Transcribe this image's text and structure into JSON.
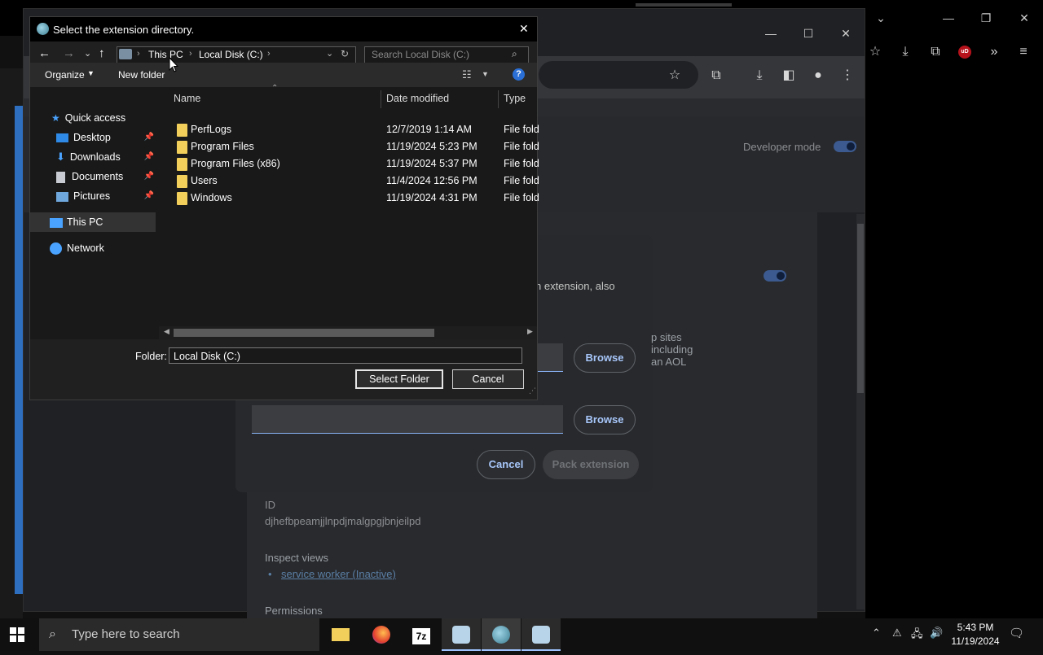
{
  "file_dialog": {
    "title": "Select the extension directory.",
    "close": "✕",
    "address": {
      "segments": [
        "This PC",
        "Local Disk (C:)"
      ]
    },
    "search_placeholder": "Search Local Disk (C:)",
    "organize_label": "Organize",
    "new_folder_label": "New folder",
    "help": "?",
    "nav_pane": {
      "quick_access": "Quick access",
      "items": [
        {
          "label": "Desktop"
        },
        {
          "label": "Downloads"
        },
        {
          "label": "Documents"
        },
        {
          "label": "Pictures"
        }
      ],
      "this_pc": "This PC",
      "network": "Network"
    },
    "columns": {
      "name": "Name",
      "date": "Date modified",
      "type": "Type"
    },
    "rows": [
      {
        "name": "PerfLogs",
        "date": "12/7/2019 1:14 AM",
        "type": "File fold"
      },
      {
        "name": "Program Files",
        "date": "11/19/2024 5:23 PM",
        "type": "File fold"
      },
      {
        "name": "Program Files (x86)",
        "date": "11/19/2024 5:37 PM",
        "type": "File fold"
      },
      {
        "name": "Users",
        "date": "11/4/2024 12:56 PM",
        "type": "File fold"
      },
      {
        "name": "Windows",
        "date": "11/19/2024 4:31 PM",
        "type": "File fold"
      }
    ],
    "folder_label": "Folder:",
    "folder_value": "Local Disk (C:)",
    "select_button": "Select Folder",
    "cancel_button": "Cancel"
  },
  "browser": {
    "developer_mode_label": "Developer mode",
    "pack_dialog": {
      "fragment_text": "n extension, also",
      "fragment_text_2": "p sites including an AOL",
      "browse_label_1": "Browse",
      "browse_label_2": "Browse",
      "cancel_label": "Cancel",
      "pack_label": "Pack extension"
    },
    "details": {
      "id_label": "ID",
      "id_value": "djhefbpeamjjlnpdjmalgpgjbnjeilpd",
      "inspect_views_label": "Inspect views",
      "service_worker_link": "service worker (Inactive)",
      "permissions_label": "Permissions"
    }
  },
  "taskbar": {
    "search_placeholder": "Type here to search",
    "time": "5:43 PM",
    "date": "11/19/2024"
  },
  "colors": {
    "accent": "#8ab4f8",
    "folder": "#f2cf5a",
    "taskbar_active": "#9ec3ff"
  }
}
